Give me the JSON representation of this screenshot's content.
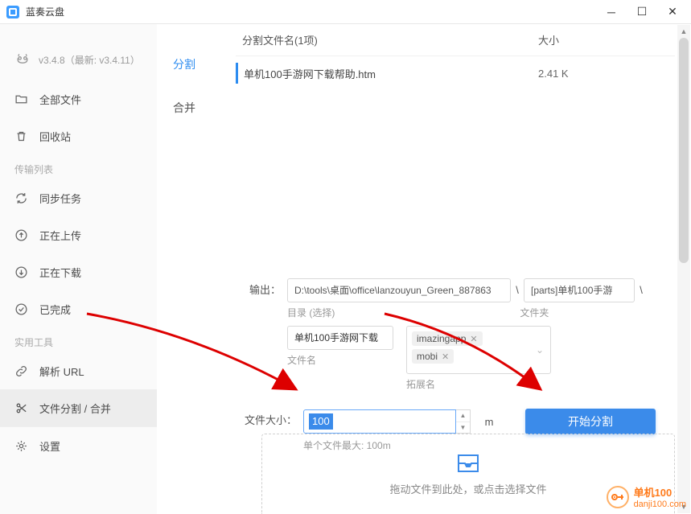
{
  "app": {
    "title": "蓝奏云盘"
  },
  "version": {
    "text": "v3.4.8（最新: v3.4.11）"
  },
  "sidebar": {
    "allFiles": "全部文件",
    "recycle": "回收站",
    "sectionTransfer": "传输列表",
    "sync": "同步任务",
    "uploading": "正在上传",
    "downloading": "正在下载",
    "completed": "已完成",
    "sectionTool": "实用工具",
    "parseUrl": "解析 URL",
    "splitMerge": "文件分割 / 合并",
    "settings": "设置"
  },
  "tabs": {
    "split": "分割",
    "merge": "合并"
  },
  "table": {
    "header": {
      "name": "分割文件名(1项)",
      "size": "大小"
    },
    "row": {
      "name": "单机100手游网下载帮助.htm",
      "size": "2.41 K"
    }
  },
  "form": {
    "output_label": "输出：",
    "dir_label": "目录",
    "dir_select": "(选择)",
    "folder_label": "文件夹",
    "output_path": "D:\\tools\\桌面\\office\\lanzouyun_Green_887863",
    "output_folder": "[parts]单机100手游",
    "filename_label": "文件名",
    "filename": "单机100手游网下载",
    "ext_label": "拓展名",
    "ext_tags": [
      "imazingapp",
      "mobi"
    ],
    "size_label": "文件大小：",
    "size_value": "100",
    "unit": "m",
    "hint": "单个文件最大: 100m",
    "start": "开始分割"
  },
  "drop": {
    "text": "拖动文件到此处，或点击选择文件"
  },
  "watermark": {
    "line1": "单机100",
    "line2": "danji100.com"
  }
}
